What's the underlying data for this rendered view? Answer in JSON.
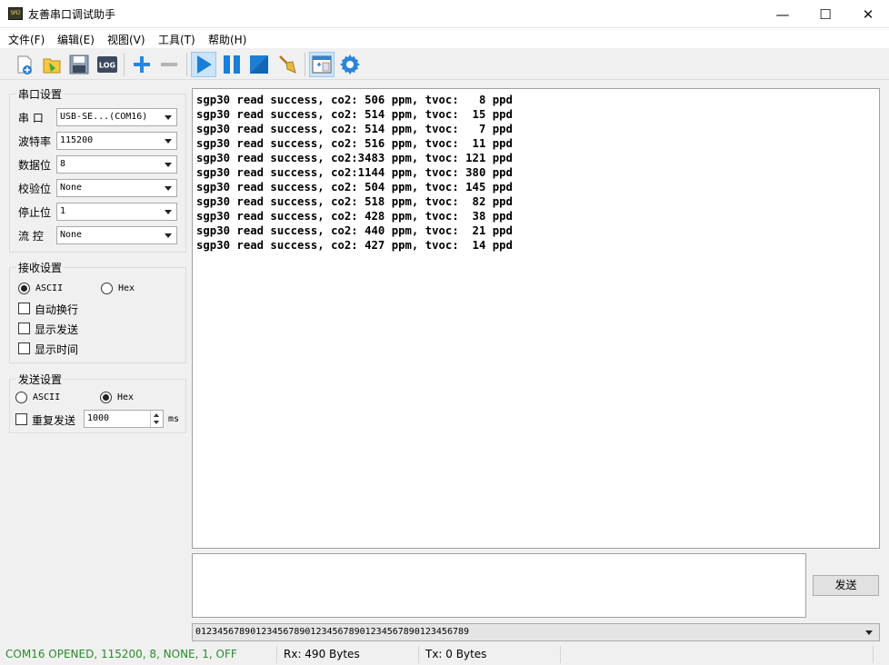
{
  "window": {
    "title": "友善串口调试助手",
    "icon_label": "SMJ",
    "minimize_glyph": "—",
    "maximize_glyph": "☐",
    "close_glyph": "✕"
  },
  "menu": [
    "文件(F)",
    "编辑(E)",
    "视图(V)",
    "工具(T)",
    "帮助(H)"
  ],
  "toolbar": {
    "log_label": "LOG",
    "icons": [
      "new-session-icon",
      "open-folder-icon",
      "save-disk-icon",
      "log-icon",
      "add-icon",
      "remove-icon",
      "play-icon",
      "pause-icon",
      "stop-icon",
      "broom-clear-icon",
      "window-layout-icon",
      "gear-icon"
    ],
    "active": "play-icon"
  },
  "serial_settings": {
    "title": "串口设置",
    "fields": [
      {
        "label": "串 口",
        "value": "USB-SE...(COM16)"
      },
      {
        "label": "波特率",
        "value": "115200"
      },
      {
        "label": "数据位",
        "value": "8"
      },
      {
        "label": "校验位",
        "value": "None"
      },
      {
        "label": "停止位",
        "value": "1"
      },
      {
        "label": "流 控",
        "value": "None"
      }
    ]
  },
  "receive_settings": {
    "title": "接收设置",
    "ascii_label": "ASCII",
    "hex_label": "Hex",
    "selected": "ASCII",
    "checkboxes": [
      {
        "label": "自动换行",
        "checked": false
      },
      {
        "label": "显示发送",
        "checked": false
      },
      {
        "label": "显示时间",
        "checked": false
      }
    ]
  },
  "send_settings": {
    "title": "发送设置",
    "ascii_label": "ASCII",
    "hex_label": "Hex",
    "selected": "Hex",
    "repeat_label": "重复发送",
    "repeat_checked": false,
    "interval_value": "1000",
    "interval_unit": "ms"
  },
  "receive_lines": [
    "sgp30 read success, co2: 506 ppm, tvoc:   8 ppd",
    "sgp30 read success, co2: 514 ppm, tvoc:  15 ppd",
    "sgp30 read success, co2: 514 ppm, tvoc:   7 ppd",
    "sgp30 read success, co2: 516 ppm, tvoc:  11 ppd",
    "sgp30 read success, co2:3483 ppm, tvoc: 121 ppd",
    "sgp30 read success, co2:1144 ppm, tvoc: 380 ppd",
    "sgp30 read success, co2: 504 ppm, tvoc: 145 ppd",
    "sgp30 read success, co2: 518 ppm, tvoc:  82 ppd",
    "sgp30 read success, co2: 428 ppm, tvoc:  38 ppd",
    "sgp30 read success, co2: 440 ppm, tvoc:  21 ppd",
    "sgp30 read success, co2: 427 ppm, tvoc:  14 ppd"
  ],
  "send_box": {
    "value": "",
    "button_label": "发送"
  },
  "history": {
    "value": "01234567890123456789012345678901234567890123456789"
  },
  "status": {
    "connection": "COM16 OPENED, 115200, 8, NONE, 1, OFF",
    "connection_color": "#2a8a2a",
    "rx": "Rx: 490 Bytes",
    "tx": "Tx: 0 Bytes"
  }
}
